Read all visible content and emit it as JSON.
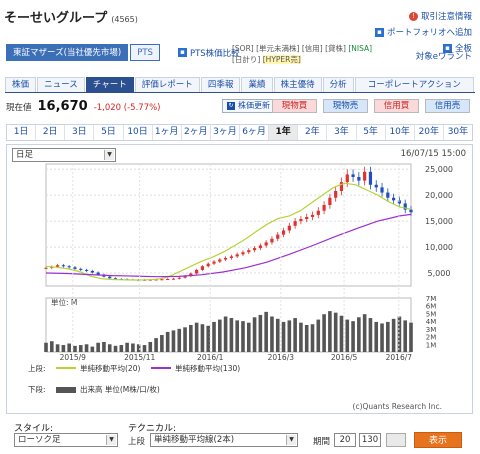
{
  "header": {
    "company": "そーせいグループ",
    "code": "(4565)",
    "links": [
      "取引注意情報",
      "ポートフォリオへ追加",
      "全板"
    ]
  },
  "market": {
    "active": "東証マザーズ(当社優先市場)",
    "other": "PTS",
    "pts_compare": "PTS株価比較",
    "tags": [
      {
        "label": "[SOR]"
      },
      {
        "label": "[単元未満株]"
      },
      {
        "label": "[信用]"
      },
      {
        "label": "[貸株]"
      },
      {
        "label": "[NISA]",
        "nisa": true
      },
      {
        "label": "[日計り]"
      },
      {
        "label": "[HYPER売]",
        "hyper": true
      }
    ],
    "warrant": "対象eワラント"
  },
  "tabs": [
    {
      "label": "株価",
      "active": false
    },
    {
      "label": "ニュース",
      "active": false
    },
    {
      "label": "チャート",
      "active": true
    },
    {
      "label": "評価レポート",
      "active": false
    },
    {
      "label": "四季報",
      "active": false
    },
    {
      "label": "業績",
      "active": false
    },
    {
      "label": "株主優待",
      "active": false
    },
    {
      "label": "分析",
      "active": false
    },
    {
      "label": "コーポレートアクション",
      "active": false
    }
  ],
  "price": {
    "label": "現在値",
    "value": "16,670",
    "change": "-1,020 (-5.77%)"
  },
  "update_button": "株価更新",
  "trade_buttons": [
    "現物買",
    "現物売",
    "信用買",
    "信用売"
  ],
  "periods": [
    {
      "label": "1日",
      "active": false
    },
    {
      "label": "2日",
      "active": false
    },
    {
      "label": "3日",
      "active": false
    },
    {
      "label": "5日",
      "active": false
    },
    {
      "label": "10日",
      "active": false
    },
    {
      "label": "1ヶ月",
      "active": false
    },
    {
      "label": "2ヶ月",
      "active": false
    },
    {
      "label": "3ヶ月",
      "active": false
    },
    {
      "label": "6ヶ月",
      "active": false
    },
    {
      "label": "1年",
      "active": true
    },
    {
      "label": "2年",
      "active": false
    },
    {
      "label": "3年",
      "active": false
    },
    {
      "label": "5年",
      "active": false
    },
    {
      "label": "10年",
      "active": false
    },
    {
      "label": "20年",
      "active": false
    },
    {
      "label": "30年",
      "active": false
    }
  ],
  "chart_controls": {
    "interval": "日足",
    "timestamp": "16/07/15 15:00",
    "copyright": "(c)Quants Research Inc."
  },
  "chart_data": {
    "type": "line",
    "series": [
      {
        "name": "単純移動平均(20)",
        "color": "#b6d334",
        "points": [
          [
            0,
            6300
          ],
          [
            8,
            6100
          ],
          [
            16,
            5800
          ],
          [
            24,
            5300
          ],
          [
            32,
            4400
          ],
          [
            40,
            3900
          ],
          [
            48,
            3750
          ],
          [
            56,
            3700
          ],
          [
            64,
            3650
          ],
          [
            72,
            3700
          ],
          [
            80,
            3800
          ],
          [
            88,
            4200
          ],
          [
            96,
            5200
          ],
          [
            104,
            6200
          ],
          [
            112,
            7200
          ],
          [
            120,
            8000
          ],
          [
            128,
            9000
          ],
          [
            136,
            10200
          ],
          [
            144,
            11500
          ],
          [
            152,
            13000
          ],
          [
            160,
            14400
          ],
          [
            168,
            15500
          ],
          [
            176,
            16000
          ],
          [
            184,
            17000
          ],
          [
            192,
            18500
          ],
          [
            200,
            20000
          ],
          [
            208,
            21500
          ],
          [
            216,
            22300
          ],
          [
            224,
            22000
          ],
          [
            232,
            21000
          ],
          [
            240,
            20000
          ],
          [
            248,
            18700
          ],
          [
            256,
            17700
          ],
          [
            264,
            17300
          ]
        ]
      },
      {
        "name": "単純移動平均(130)",
        "color": "#9b2fd3",
        "points": [
          [
            0,
            5000
          ],
          [
            16,
            4900
          ],
          [
            32,
            4700
          ],
          [
            48,
            4500
          ],
          [
            64,
            4400
          ],
          [
            80,
            4300
          ],
          [
            96,
            4350
          ],
          [
            112,
            4650
          ],
          [
            128,
            5200
          ],
          [
            144,
            6000
          ],
          [
            160,
            7100
          ],
          [
            176,
            8600
          ],
          [
            192,
            10200
          ],
          [
            208,
            11900
          ],
          [
            224,
            13500
          ],
          [
            240,
            15000
          ],
          [
            256,
            16000
          ],
          [
            264,
            16300
          ]
        ]
      }
    ],
    "candles_close": [
      6000,
      6200,
      6500,
      6300,
      6100,
      5800,
      5600,
      5400,
      5100,
      4700,
      4300,
      4000,
      3850,
      3800,
      3750,
      3700,
      3680,
      3700,
      3720,
      3760,
      3800,
      3850,
      3900,
      4100,
      4400,
      4900,
      5600,
      6300,
      6800,
      7200,
      7600,
      7900,
      8200,
      8600,
      9000,
      9400,
      9800,
      10300,
      10900,
      11600,
      12400,
      13200,
      14100,
      15000,
      15400,
      15800,
      16200,
      17000,
      18100,
      19500,
      20800,
      22500,
      24000,
      23500,
      22800,
      24500,
      22000,
      21500,
      20500,
      19500,
      19000,
      18400,
      17200,
      16700
    ],
    "volume": [
      1.2,
      1.4,
      1.0,
      0.9,
      1.1,
      0.8,
      0.9,
      1.0,
      0.7,
      1.2,
      1.3,
      1.0,
      0.8,
      0.9,
      1.2,
      1.1,
      1.0,
      0.9,
      1.3,
      1.8,
      2.2,
      2.6,
      2.8,
      3.0,
      3.2,
      3.5,
      3.8,
      3.6,
      3.4,
      3.9,
      4.2,
      4.6,
      4.4,
      4.1,
      4.0,
      3.8,
      4.5,
      4.8,
      5.2,
      4.6,
      4.3,
      3.9,
      4.1,
      4.4,
      3.8,
      3.5,
      3.6,
      4.2,
      4.9,
      5.3,
      5.1,
      4.7,
      4.2,
      4.0,
      4.5,
      4.9,
      4.4,
      3.9,
      3.7,
      3.9,
      4.3,
      4.6,
      4.1,
      3.8
    ],
    "ylim": [
      2500,
      26000
    ],
    "yticks": [
      "25,000",
      "20,000",
      "15,000",
      "10,000",
      "5,000"
    ],
    "xlabels": [
      "2015/9",
      "2015/11",
      "2016/1",
      "2016/3",
      "2016/5",
      "2016/7"
    ],
    "volume_unit": "単位: M",
    "volume_ticks": [
      "7M",
      "6M",
      "5M",
      "4M",
      "3M",
      "2M",
      "1M"
    ],
    "legend_upper_label": "上段:",
    "legend_lower_label": "下段:",
    "legend_volume": "出来高 単位(M株/口/枚)"
  },
  "controls": {
    "style_label": "スタイル:",
    "style_value": "ローソク足",
    "tech_label": "テクニカル:",
    "tech_upper": "上段",
    "tech_value": "単純移動平均線(2本)",
    "period_label": "期間",
    "period_1": "20",
    "period_2": "130",
    "show_button": "表示"
  }
}
